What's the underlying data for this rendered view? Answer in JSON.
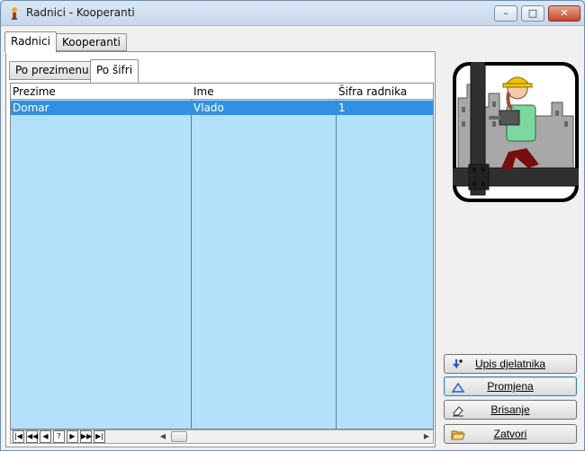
{
  "window": {
    "title": "Radnici - Kooperanti",
    "controls": {
      "minimize": "–",
      "maximize": "□",
      "close": "✕"
    }
  },
  "outer_tabs": [
    {
      "label": "Radnici",
      "active": true
    },
    {
      "label": "Kooperanti",
      "active": false
    }
  ],
  "inner_tabs": [
    {
      "label": "Po prezimenu",
      "active": false
    },
    {
      "label": "Po šifri",
      "active": true
    }
  ],
  "grid": {
    "columns": [
      "Prezime",
      "Ime",
      "Šifra radnika"
    ],
    "rows": [
      {
        "prezime": "Domar",
        "ime": "Vlado",
        "sifra": "1",
        "selected": true
      }
    ],
    "colors": {
      "background": "#b3e0fb",
      "selected": "#3390e0"
    }
  },
  "navigator": {
    "buttons": [
      "first",
      "prev-page",
      "prev",
      "help",
      "next",
      "next-page",
      "last"
    ],
    "symbols": [
      "|◀",
      "◀◀",
      "◀",
      "?",
      "▶",
      "▶▶",
      "▶|"
    ]
  },
  "actions": {
    "add": "Upis djelatnika",
    "edit": "Promjena",
    "delete": "Brisanje",
    "close": "Zatvori"
  }
}
